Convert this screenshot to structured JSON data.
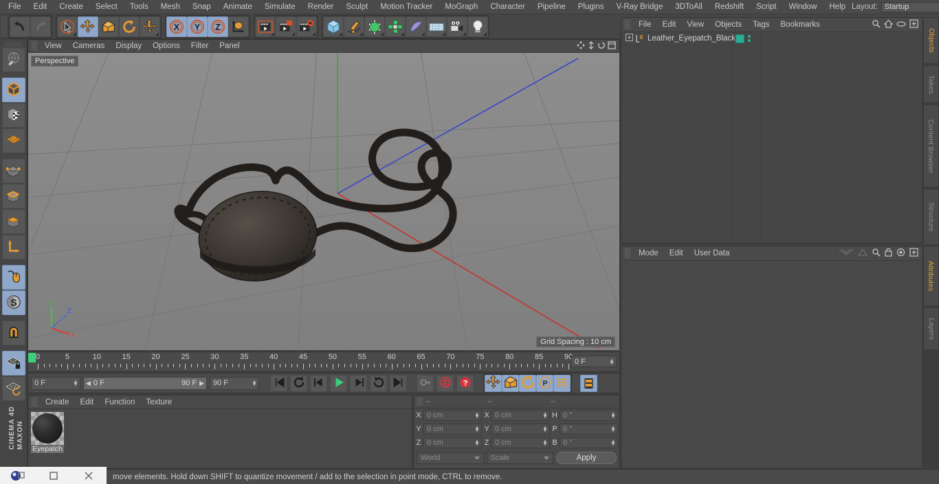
{
  "app": {
    "name": "MAXON CINEMA 4D",
    "brand_line1": "MAXON",
    "brand_line2": "CINEMA 4D"
  },
  "menubar": {
    "items": [
      {
        "label": "File"
      },
      {
        "label": "Edit"
      },
      {
        "label": "Create"
      },
      {
        "label": "Select"
      },
      {
        "label": "Tools"
      },
      {
        "label": "Mesh"
      },
      {
        "label": "Snap"
      },
      {
        "label": "Animate"
      },
      {
        "label": "Simulate"
      },
      {
        "label": "Render"
      },
      {
        "label": "Sculpt"
      },
      {
        "label": "Motion Tracker"
      },
      {
        "label": "MoGraph"
      },
      {
        "label": "Character"
      },
      {
        "label": "Pipeline"
      },
      {
        "label": "Plugins"
      },
      {
        "label": "V-Ray Bridge"
      },
      {
        "label": "3DToAll"
      },
      {
        "label": "Redshift"
      },
      {
        "label": "Script"
      },
      {
        "label": "Window"
      },
      {
        "label": "Help"
      }
    ],
    "layout_label": "Layout:",
    "layout_value": "Startup",
    "search_icon": "search-icon"
  },
  "toolbar": {
    "groups": [
      {
        "name": "history",
        "buttons": [
          {
            "name": "undo-button",
            "icon": "undo-icon",
            "selected": false,
            "corner": false
          },
          {
            "name": "redo-button",
            "icon": "redo-icon",
            "selected": false,
            "corner": false
          }
        ]
      },
      {
        "name": "tools",
        "buttons": [
          {
            "name": "live-selection-button",
            "icon": "cursor-select-icon",
            "selected": false,
            "corner": true
          },
          {
            "name": "move-button",
            "icon": "move-icon",
            "selected": true,
            "corner": false
          },
          {
            "name": "scale-button",
            "icon": "scale-icon",
            "selected": false,
            "corner": false
          },
          {
            "name": "rotate-button",
            "icon": "rotate-icon",
            "selected": false,
            "corner": false
          },
          {
            "name": "move-alt-button",
            "icon": "move-icon",
            "selected": false,
            "corner": true
          }
        ]
      },
      {
        "name": "axis-locks",
        "buttons": [
          {
            "name": "lock-x-button",
            "icon": "axis-x-icon",
            "selected": true,
            "corner": false
          },
          {
            "name": "lock-y-button",
            "icon": "axis-y-icon",
            "selected": true,
            "corner": false
          },
          {
            "name": "lock-z-button",
            "icon": "axis-z-icon",
            "selected": true,
            "corner": false
          },
          {
            "name": "world-object-axis-button",
            "icon": "world-axis-icon",
            "selected": false,
            "corner": false
          }
        ]
      },
      {
        "name": "render",
        "buttons": [
          {
            "name": "render-view-button",
            "icon": "render-view-icon",
            "selected": false,
            "corner": true
          },
          {
            "name": "render-region-button",
            "icon": "render-region-icon",
            "selected": false,
            "corner": true
          },
          {
            "name": "render-settings-button",
            "icon": "render-settings-icon",
            "selected": false,
            "corner": true
          }
        ]
      },
      {
        "name": "creation",
        "buttons": [
          {
            "name": "add-cube-button",
            "icon": "cube-primitive-icon",
            "selected": false,
            "corner": true
          },
          {
            "name": "add-spline-button",
            "icon": "pen-spline-icon",
            "selected": false,
            "corner": true
          },
          {
            "name": "add-generator-button",
            "icon": "green-cube-icon",
            "selected": false,
            "corner": true
          },
          {
            "name": "add-array-button",
            "icon": "array-icon",
            "selected": false,
            "corner": true
          },
          {
            "name": "add-deformer-button",
            "icon": "bend-deformer-icon",
            "selected": false,
            "corner": true
          },
          {
            "name": "add-environment-button",
            "icon": "floor-environment-icon",
            "selected": false,
            "corner": true
          },
          {
            "name": "add-camera-button",
            "icon": "camera-icon",
            "selected": false,
            "corner": true
          },
          {
            "name": "add-light-button",
            "icon": "light-bulb-icon",
            "selected": false,
            "corner": true
          }
        ]
      }
    ]
  },
  "leftbar": {
    "buttons": [
      {
        "name": "make-editable-button",
        "icon": "make-editable-icon",
        "selected": false
      },
      {
        "name": "model-mode-button",
        "icon": "model-mode-cube-icon",
        "selected": true
      },
      {
        "name": "texture-mode-button",
        "icon": "texture-checker-icon",
        "selected": false
      },
      {
        "name": "polygon-grid-button",
        "icon": "polygon-grid-icon",
        "selected": false
      },
      {
        "name": "point-mode-button",
        "icon": "point-mode-icon",
        "selected": false
      },
      {
        "name": "edge-mode-button",
        "icon": "edge-mode-icon",
        "selected": false
      },
      {
        "name": "polygon-mode-button",
        "icon": "polygon-mode-icon",
        "selected": false
      },
      {
        "name": "axis-mode-button",
        "icon": "axis-mode-icon",
        "selected": false
      },
      {
        "name": "viewport-solo-button",
        "icon": "mouse-icon",
        "selected": true
      },
      {
        "name": "soft-selection-button",
        "icon": "s-circle-icon",
        "selected": true
      },
      {
        "name": "magnet-button",
        "icon": "magnet-icon",
        "selected": false
      },
      {
        "name": "lock-workplane-button",
        "icon": "workplane-lock-icon",
        "selected": true
      },
      {
        "name": "workplane-rotate-button",
        "icon": "workplane-rotate-icon",
        "selected": false
      }
    ]
  },
  "viewport": {
    "menu": [
      {
        "label": "View"
      },
      {
        "label": "Cameras"
      },
      {
        "label": "Display"
      },
      {
        "label": "Options"
      },
      {
        "label": "Filter"
      },
      {
        "label": "Panel"
      }
    ],
    "label": "Perspective",
    "grid_spacing": "Grid Spacing : 10 cm",
    "axis_labels": {
      "x": "X",
      "y": "Y",
      "z": "Z"
    },
    "colors": {
      "background_top": "#8d8d8d",
      "background_bottom": "#828282",
      "grid_line": "#777777",
      "axis_x": "#c4342f",
      "axis_y": "#3ca53c",
      "axis_z": "#3a46c8",
      "object": "#2a2623"
    },
    "scene_object": "Leather eyepatch with black strap"
  },
  "object_manager": {
    "menu": [
      {
        "label": "File"
      },
      {
        "label": "Edit"
      },
      {
        "label": "View"
      },
      {
        "label": "Objects"
      },
      {
        "label": "Tags"
      },
      {
        "label": "Bookmarks"
      }
    ],
    "icons": [
      "search-icon",
      "home-icon",
      "eye-icon",
      "plus-box-icon"
    ],
    "rows": [
      {
        "name": "Leather_Eyepatch_Black",
        "level_badge": "0",
        "tag_color": "#2eae96"
      }
    ]
  },
  "attribute_manager": {
    "menu": [
      {
        "label": "Mode"
      },
      {
        "label": "Edit"
      },
      {
        "label": "User Data"
      }
    ],
    "icons": [
      "history-back-icon",
      "history-forward-icon",
      "search-icon",
      "lock-icon",
      "target-icon",
      "plus-box-icon"
    ]
  },
  "right_dock": {
    "top_tabs": [
      {
        "label": "Objects",
        "active": true
      },
      {
        "label": "Takes",
        "active": false
      },
      {
        "label": "Content Browser",
        "active": false
      },
      {
        "label": "Structure",
        "active": false
      }
    ],
    "bottom_tabs": [
      {
        "label": "Attributes",
        "active": true
      },
      {
        "label": "Layers",
        "active": false
      }
    ]
  },
  "timeline": {
    "ticks": [
      "0",
      "5",
      "10",
      "15",
      "20",
      "25",
      "30",
      "35",
      "40",
      "45",
      "50",
      "55",
      "60",
      "65",
      "70",
      "75",
      "80",
      "85",
      "90"
    ],
    "frame_min": 0,
    "frame_max": 90,
    "current_frame_field": "0 F",
    "playhead_frame": 0
  },
  "powerbar": {
    "current_frame": "0 F",
    "range_start": "0 F",
    "range_end": "90 F",
    "end_frame": "90 F",
    "transport": [
      {
        "name": "go-to-start-button",
        "icon": "skip-start-icon"
      },
      {
        "name": "play-backward-loop-button",
        "icon": "loop-back-icon"
      },
      {
        "name": "step-back-button",
        "icon": "step-back-icon"
      },
      {
        "name": "play-button",
        "icon": "play-icon"
      },
      {
        "name": "step-forward-button",
        "icon": "step-forward-icon"
      },
      {
        "name": "loop-forward-button",
        "icon": "loop-forward-icon"
      },
      {
        "name": "go-to-end-button",
        "icon": "skip-end-icon"
      }
    ],
    "record": [
      {
        "name": "autokey-button",
        "icon": "key-icon"
      },
      {
        "name": "record-active-objects-button",
        "icon": "record-circle-icon"
      },
      {
        "name": "record-question-button",
        "icon": "question-circle-icon"
      }
    ],
    "keyframe_filters": [
      {
        "name": "position-key-button",
        "icon": "move-icon",
        "selected": true
      },
      {
        "name": "scale-key-button",
        "icon": "scale-icon",
        "selected": true
      },
      {
        "name": "rotation-key-button",
        "icon": "rotate-icon",
        "selected": true
      },
      {
        "name": "param-key-button",
        "icon": "p-circle-icon",
        "selected": true
      },
      {
        "name": "point-level-anim-button",
        "icon": "pla-dots-icon",
        "selected": true
      }
    ],
    "timeline_toggle": {
      "name": "timeline-toggle-button",
      "icon": "film-strip-icon",
      "selected": true
    }
  },
  "material_manager": {
    "menu": [
      {
        "label": "Create"
      },
      {
        "label": "Edit"
      },
      {
        "label": "Function"
      },
      {
        "label": "Texture"
      }
    ],
    "materials": [
      {
        "name": "Eyepatch",
        "color": "#1d1a18"
      }
    ]
  },
  "coordinate_manager": {
    "headers": [
      "--",
      "--",
      "--"
    ],
    "position": [
      {
        "label": "X",
        "value": "0 cm"
      },
      {
        "label": "Y",
        "value": "0 cm"
      },
      {
        "label": "Z",
        "value": "0 cm"
      }
    ],
    "size": [
      {
        "label": "X",
        "value": "0 cm"
      },
      {
        "label": "Y",
        "value": "0 cm"
      },
      {
        "label": "Z",
        "value": "0 cm"
      }
    ],
    "rotation": [
      {
        "label": "H",
        "value": "0 °"
      },
      {
        "label": "P",
        "value": "0 °"
      },
      {
        "label": "B",
        "value": "0 °"
      }
    ],
    "system": "World",
    "mode": "Scale",
    "apply_label": "Apply"
  },
  "statusbar": {
    "message": "move elements. Hold down SHIFT to quantize movement / add to the selection in point mode, CTRL to remove."
  },
  "taskbar": {
    "items": [
      {
        "name": "app-icon",
        "icon": "c4d-orb-icon"
      },
      {
        "name": "maximize-button",
        "icon": "square-icon"
      },
      {
        "name": "close-button",
        "icon": "close-icon"
      }
    ]
  }
}
